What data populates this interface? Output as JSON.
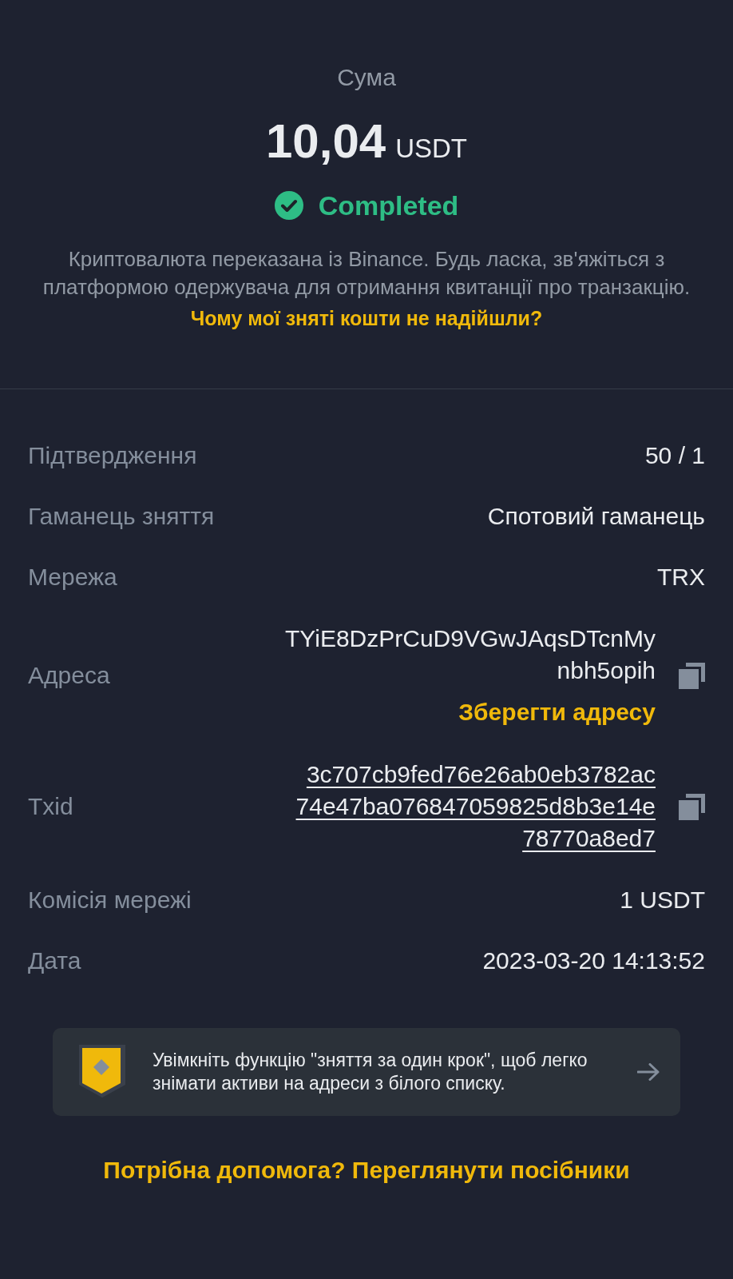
{
  "summary": {
    "label": "Сума",
    "amount": "10,04",
    "currency": "USDT",
    "status": {
      "kind": "completed",
      "text": "Completed"
    },
    "description": "Криптовалюта переказана із Binance. Будь ласка, зв'яжіться з платформою одержувача для отримання квитанції про транзакцію.",
    "help_link": "Чому мої зняті кошти не надійшли?"
  },
  "details": [
    {
      "kind": "text",
      "label": "Підтвердження",
      "value": "50 / 1"
    },
    {
      "kind": "text",
      "label": "Гаманець зняття",
      "value": "Спотовий гаманець"
    },
    {
      "kind": "text",
      "label": "Мережа",
      "value": "TRX"
    },
    {
      "kind": "address",
      "label": "Адреса",
      "value_lines": [
        "TYiE8DzPrCuD9VGwJAqsDTcnMy",
        "nbh5opih"
      ],
      "action": "Зберегти адресу",
      "copyable": true
    },
    {
      "kind": "link",
      "label": "Txid",
      "value_lines": [
        "3c707cb9fed76e26ab0eb3782ac",
        "74e47ba076847059825d8b3e14e",
        "78770a8ed7"
      ],
      "copyable": true
    },
    {
      "kind": "text",
      "label": "Комісія мережі",
      "value": "1 USDT"
    },
    {
      "kind": "text",
      "label": "Дата",
      "value": "2023-03-20 14:13:52"
    }
  ],
  "banner": {
    "text": "Увімкніть функцію \"зняття за один крок\", щоб легко знімати активи на адреси з білого списку."
  },
  "footer_link": "Потрібна допомога? Переглянути посібники"
}
